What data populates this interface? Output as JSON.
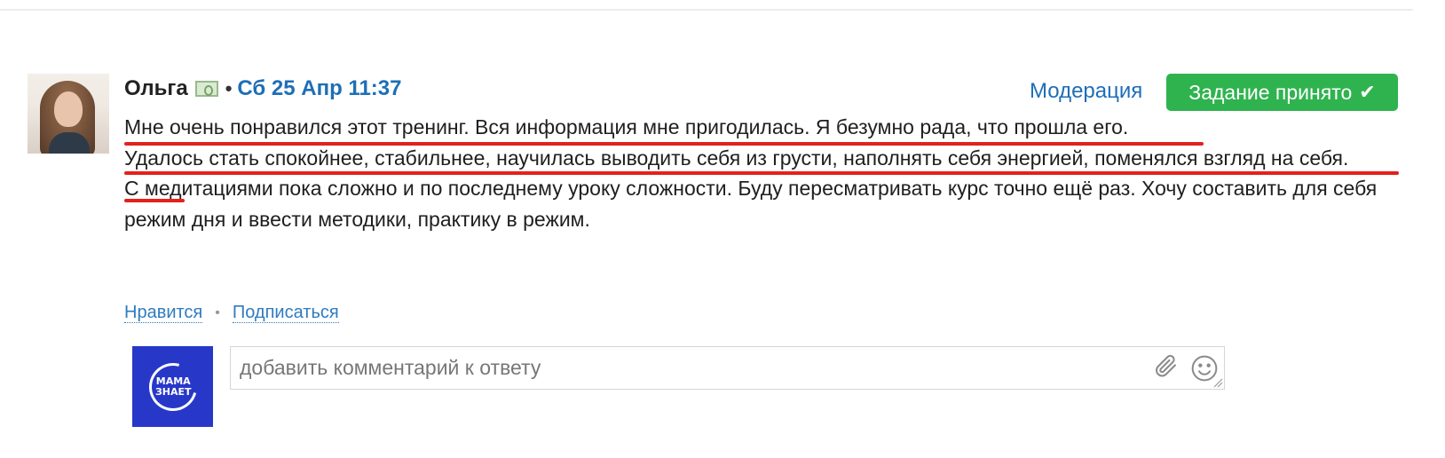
{
  "post": {
    "author": "Ольга",
    "separator": "•",
    "date": "Сб 25 Апр 11:37",
    "moderation_label": "Модерация",
    "status_label": "Задание принято",
    "answer_lines": [
      "Мне очень понравился этот тренинг. Вся информация мне пригодилась. Я безумно рада, что прошла его.",
      "Удалось стать спокойнее, стабильнее, научилась выводить себя из грусти, наполнять себя энергией, поменялся взгляд на себя.",
      "С медитациями пока сложно и по последнему уроку сложности. Буду пересматривать курс точно ещё раз. Хочу составить для себя режим дня и ввести методики, практику в режим."
    ]
  },
  "actions": {
    "like_label": "Нравится",
    "separator": "•",
    "subscribe_label": "Подписаться"
  },
  "comment": {
    "logo_text_line1": "МАМА",
    "logo_text_line2": "ЗНАЕТ",
    "placeholder": "добавить комментарий к ответу"
  },
  "colors": {
    "link": "#1e6eb7",
    "accepted": "#2fb34f",
    "highlight": "#e3211c",
    "logo_bg": "#2738c9"
  },
  "icons": {
    "author_badge": "money-icon",
    "status": "check-icon",
    "attach": "paperclip-icon",
    "emoji": "smile-icon",
    "resize": "resize-handle-icon"
  }
}
